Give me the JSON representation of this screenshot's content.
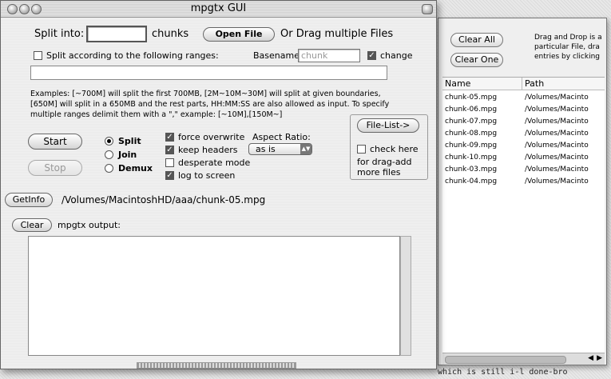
{
  "background": {
    "bottom_text": "which is still i-l  done-bro"
  },
  "list_window": {
    "clear_all_label": "Clear All",
    "clear_one_label": "Clear One",
    "hint": "Drag and Drop is a\nparticular File, dra\nentries by clicking",
    "columns": [
      "Name",
      "Path"
    ],
    "rows": [
      {
        "name": "chunk-05.mpg",
        "path": "/Volumes/Macinto"
      },
      {
        "name": "chunk-06.mpg",
        "path": "/Volumes/Macinto"
      },
      {
        "name": "chunk-07.mpg",
        "path": "/Volumes/Macinto"
      },
      {
        "name": "chunk-08.mpg",
        "path": "/Volumes/Macinto"
      },
      {
        "name": "chunk-09.mpg",
        "path": "/Volumes/Macinto"
      },
      {
        "name": "chunk-10.mpg",
        "path": "/Volumes/Macinto"
      },
      {
        "name": "chunk-03.mpg",
        "path": "/Volumes/Macinto"
      },
      {
        "name": "chunk-04.mpg",
        "path": "/Volumes/Macinto"
      }
    ]
  },
  "main_window": {
    "title": "mpgtx GUI",
    "split_into_label": "Split into:",
    "chunks_value": "",
    "chunks_label": "chunks",
    "open_file_label": "Open File",
    "drag_label": "Or Drag multiple Files",
    "ranges_label": "Split according to the following ranges:",
    "ranges_checked": false,
    "basename_label": "Basename:",
    "basename_placeholder": "chunk",
    "change_label": "change",
    "change_checked": true,
    "ranges_value": "",
    "examples_text": "Examples: [~700M] will split the first 700MB, [2M~10M~30M] will split at given boundaries,\n[650M] will split in a 650MB and the rest parts, HH:MM:SS are also allowed as input. To specify\nmultiple ranges delimit them with a \",\" example: [~10M],[150M~]",
    "file_list_label": "File-List->",
    "check_here_label": "check here",
    "drag_add_text": "for drag-add\nmore files",
    "start_label": "Start",
    "stop_label": "Stop",
    "modes": [
      {
        "label": "Split",
        "selected": true
      },
      {
        "label": "Join",
        "selected": false
      },
      {
        "label": "Demux",
        "selected": false
      }
    ],
    "options": [
      {
        "label": "force overwrite",
        "checked": true
      },
      {
        "label": "keep headers",
        "checked": true
      },
      {
        "label": "desperate mode",
        "checked": false
      },
      {
        "label": "log to screen",
        "checked": true
      }
    ],
    "aspect_label": "Aspect Ratio:",
    "aspect_value": "as is",
    "getinfo_label": "GetInfo",
    "getinfo_path": "/Volumes/MacintoshHD/aaa/chunk-05.mpg",
    "clear_label": "Clear",
    "output_label": "mpgtx output:",
    "output_text": ""
  }
}
